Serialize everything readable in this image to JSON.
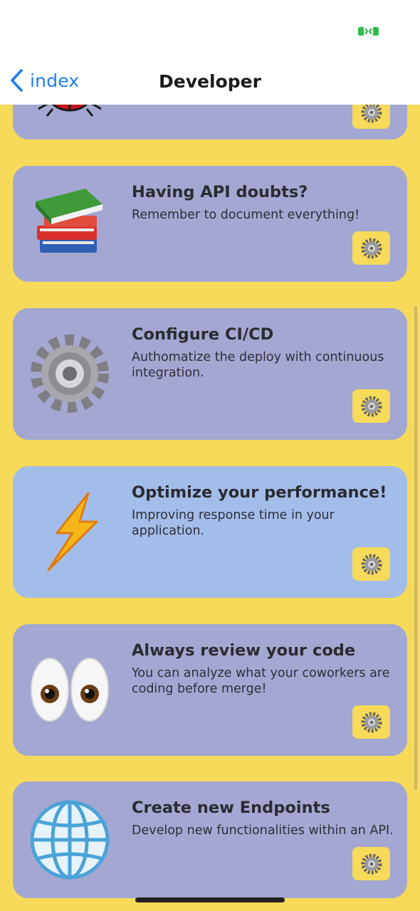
{
  "nav": {
    "back_label": "index",
    "title": "Developer"
  },
  "colors": {
    "background": "#f7da5a",
    "card": "#a4a7d2",
    "card_highlight": "#a3bdeb",
    "accent": "#1f7cf2",
    "battery": "#2bbd4d"
  },
  "cards": [
    {
      "icon": "ladybug-icon",
      "title": "",
      "description": ""
    },
    {
      "icon": "books-icon",
      "title": "Having API doubts?",
      "description": "Remember to document everything!"
    },
    {
      "icon": "gear-icon",
      "title": "Configure CI/CD",
      "description": "Authomatize the deploy with continuous integration."
    },
    {
      "icon": "lightning-icon",
      "title": "Optimize your performance!",
      "description": "Improving response time in your application."
    },
    {
      "icon": "eyes-icon",
      "title": "Always review your code",
      "description": "You can analyze what your coworkers are coding before merge!"
    },
    {
      "icon": "globe-icon",
      "title": "Create new Endpoints",
      "description": "Develop new functionalities within an API."
    }
  ]
}
